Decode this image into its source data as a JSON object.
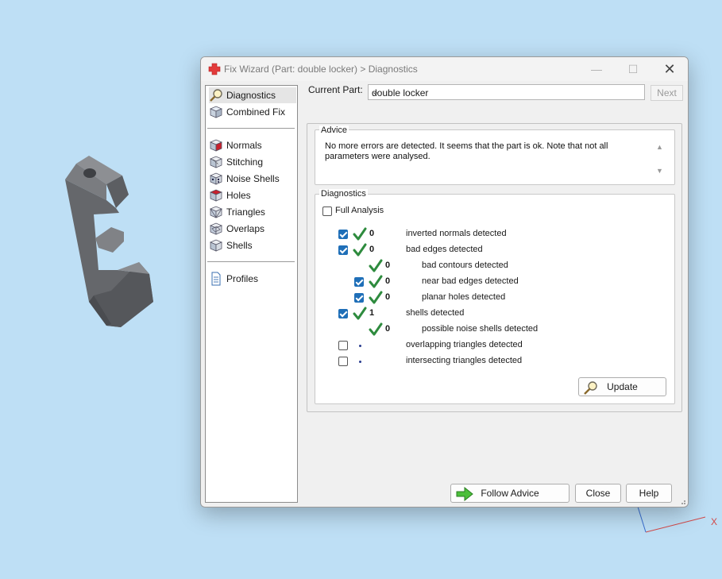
{
  "window": {
    "title": "Fix Wizard (Part: double locker) > Diagnostics"
  },
  "sidebar": {
    "items": [
      {
        "label": "Diagnostics",
        "icon": "magnifier-icon",
        "selected": true
      },
      {
        "label": "Combined Fix",
        "icon": "cube-icon"
      },
      {
        "label": "Normals",
        "icon": "normals-cube-icon"
      },
      {
        "label": "Stitching",
        "icon": "stitching-cube-icon"
      },
      {
        "label": "Noise Shells",
        "icon": "noise-shells-icon"
      },
      {
        "label": "Holes",
        "icon": "holes-cube-icon"
      },
      {
        "label": "Triangles",
        "icon": "triangles-icon"
      },
      {
        "label": "Overlaps",
        "icon": "overlaps-icon"
      },
      {
        "label": "Shells",
        "icon": "shells-icon"
      },
      {
        "label": "Profiles",
        "icon": "document-icon"
      }
    ]
  },
  "part": {
    "label": "Current Part:",
    "value": "double locker"
  },
  "next_label": "Next",
  "advice": {
    "title": "Advice",
    "text": "No more errors are detected. It seems that the part is ok. Note that not all parameters were analysed."
  },
  "diagnostics": {
    "title": "Diagnostics",
    "full_analysis_label": "Full Analysis",
    "full_analysis_checked": false,
    "rows": [
      {
        "checked": true,
        "count": "0",
        "label": "inverted normals detected"
      },
      {
        "checked": true,
        "count": "0",
        "label": "bad edges detected"
      },
      {
        "count": "0",
        "label": "bad contours detected"
      },
      {
        "checked": true,
        "count": "0",
        "label": "near bad edges detected"
      },
      {
        "checked": true,
        "count": "0",
        "label": "planar holes detected"
      },
      {
        "checked": true,
        "count": "1",
        "label": "shells detected"
      },
      {
        "count": "0",
        "label": "possible noise shells detected"
      },
      {
        "checked": false,
        "label": "overlapping triangles detected"
      },
      {
        "checked": false,
        "label": "intersecting triangles detected"
      }
    ],
    "update_label": "Update"
  },
  "footer": {
    "follow_advice_label": "Follow Advice",
    "close_label": "Close",
    "help_label": "Help"
  },
  "colors": {
    "background": "#bedff5",
    "accent": "#1f6fb8",
    "check_green": "#2e8b3e",
    "model_gray": "#6e7074"
  },
  "viewport": {
    "axis_label": "X"
  }
}
